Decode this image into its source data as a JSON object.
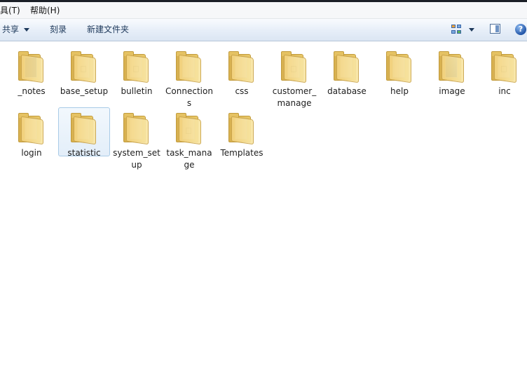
{
  "menubar": {
    "items": [
      {
        "label": "具(T)"
      },
      {
        "label": "帮助(H)"
      }
    ]
  },
  "toolbar": {
    "share_label": "共享",
    "burn_label": "刻录",
    "new_folder_label": "新建文件夹",
    "help_glyph": "?"
  },
  "folders": [
    {
      "name": "_notes",
      "style": "dark"
    },
    {
      "name": "base_setup",
      "style": "doc"
    },
    {
      "name": "bulletin",
      "style": "doc"
    },
    {
      "name": "Connections",
      "style": "plain"
    },
    {
      "name": "css",
      "style": "plain"
    },
    {
      "name": "customer_manage",
      "style": "doc"
    },
    {
      "name": "database",
      "style": "plain"
    },
    {
      "name": "help",
      "style": "plain"
    },
    {
      "name": "image",
      "style": "blue"
    },
    {
      "name": "inc",
      "style": "doc"
    },
    {
      "name": "login",
      "style": "plain"
    },
    {
      "name": "statistic",
      "style": "plain",
      "selected": true
    },
    {
      "name": "system_setup",
      "style": "plain"
    },
    {
      "name": "task_manage",
      "style": "doc"
    },
    {
      "name": "Templates",
      "style": "plain"
    }
  ]
}
